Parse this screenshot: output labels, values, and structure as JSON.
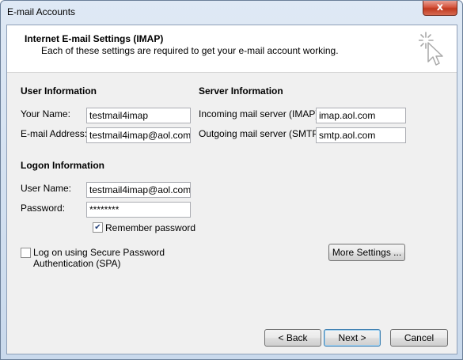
{
  "window": {
    "title": "E-mail Accounts",
    "close_label": "x"
  },
  "header": {
    "title": "Internet E-mail Settings (IMAP)",
    "subtitle": "Each of these settings are required to get your e-mail account working.",
    "icon": "cursor-click-icon"
  },
  "user_info": {
    "heading": "User Information",
    "name_label": "Your Name:",
    "name_value": "testmail4imap",
    "email_label": "E-mail Address:",
    "email_value": "testmail4imap@aol.com"
  },
  "server_info": {
    "heading": "Server Information",
    "incoming_label": "Incoming mail server (IMAP):",
    "incoming_value": "imap.aol.com",
    "outgoing_label": "Outgoing mail server (SMTP):",
    "outgoing_value": "smtp.aol.com"
  },
  "logon_info": {
    "heading": "Logon Information",
    "username_label": "User Name:",
    "username_value": "testmail4imap@aol.com",
    "password_label": "Password:",
    "password_value": "********",
    "remember_label": "Remember password",
    "remember_checked": true
  },
  "spa": {
    "line1": "Log on using Secure Password",
    "line2": "Authentication (SPA)",
    "checked": false
  },
  "buttons": {
    "more_settings": "More Settings ...",
    "back": "< Back",
    "next": "Next >",
    "cancel": "Cancel"
  },
  "colors": {
    "default_button_border": "#3c7fb1",
    "close_button": "#c0391f"
  }
}
